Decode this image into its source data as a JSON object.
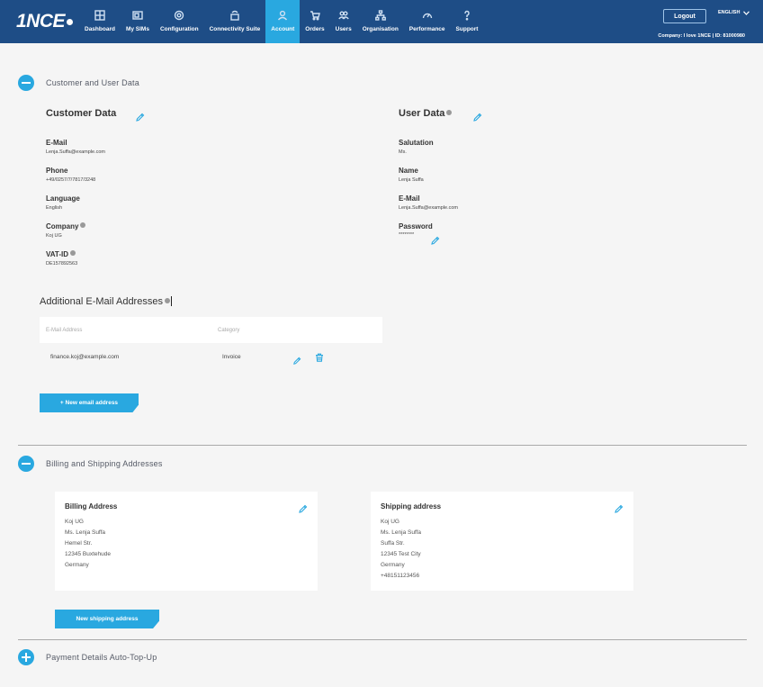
{
  "logo": {
    "text": "1NCE"
  },
  "nav": [
    {
      "label": "Dashboard",
      "icon": "dashboard-icon",
      "active": false
    },
    {
      "label": "My SIMs",
      "icon": "sim-icon",
      "active": false
    },
    {
      "label": "Configuration",
      "icon": "gear-icon",
      "active": false
    },
    {
      "label": "Connectivity Suite",
      "icon": "connectivity-icon",
      "active": false
    },
    {
      "label": "Account",
      "icon": "user-icon",
      "active": true
    },
    {
      "label": "Orders",
      "icon": "cart-icon",
      "active": false
    },
    {
      "label": "Users",
      "icon": "users-icon",
      "active": false
    },
    {
      "label": "Organisation",
      "icon": "org-chart-icon",
      "active": false
    },
    {
      "label": "Performance",
      "icon": "gauge-icon",
      "active": false
    },
    {
      "label": "Support",
      "icon": "question-icon",
      "active": false
    }
  ],
  "header": {
    "logout_label": "Logout",
    "language": "ENGLISH",
    "company_line": "Company: I love 1NCE | ID: 81000980"
  },
  "sections": {
    "customer_user": "Customer and User Data",
    "billing_shipping": "Billing and Shipping Addresses",
    "payment": "Payment Details Auto-Top-Up"
  },
  "customer": {
    "title": "Customer Data",
    "email_label": "E-Mail",
    "email_value": "Lenja.Suffa@example.com",
    "phone_label": "Phone",
    "phone_value": "+49/0257/7/7817/3248",
    "language_label": "Language",
    "language_value": "English",
    "company_label": "Company",
    "company_value": "Koj UG",
    "vat_label": "VAT-ID",
    "vat_value": "DE157892563"
  },
  "user": {
    "title": "User Data",
    "salutation_label": "Salutation",
    "salutation_value": "Ms.",
    "name_label": "Name",
    "name_value": "Lenja Suffa",
    "email_label": "E-Mail",
    "email_value": "Lenja.Suffa@example.com",
    "password_label": "Password",
    "password_value": "********"
  },
  "additional_emails": {
    "title": "Additional E-Mail Addresses",
    "columns": [
      "E-Mail Address",
      "Category"
    ],
    "rows": [
      {
        "email": "finance.koj@example.com",
        "category": "Invoice"
      }
    ],
    "new_button": "+ New email address"
  },
  "billing": {
    "title": "Billing Address",
    "lines": [
      "Koj UG",
      "Ms. Lenja Suffa",
      "Hemel Str.",
      "12345 Buxtehude",
      "Germany"
    ]
  },
  "shipping": {
    "title": "Shipping address",
    "lines": [
      "Koj UG",
      "Ms. Lenja Suffa",
      "Suffa Str.",
      "12345 Test City",
      "Germany",
      "+48151123456"
    ],
    "new_button": "New shipping address"
  },
  "colors": {
    "nav_bg": "#1e4d86",
    "accent": "#29a8e0",
    "page_bg": "#f5f5f5"
  }
}
